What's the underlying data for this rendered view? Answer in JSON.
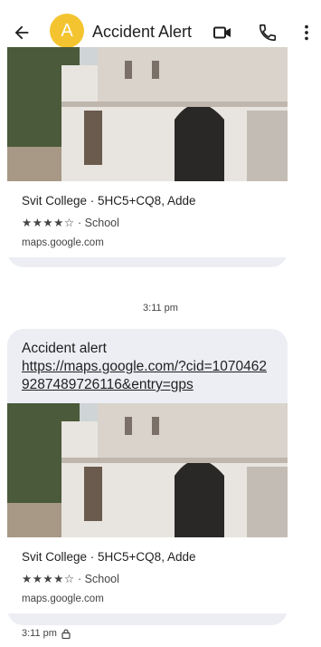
{
  "header": {
    "avatar_letter": "A",
    "title": "Accident Alert",
    "avatar_color": "#f4c430"
  },
  "messages": [
    {
      "preview": {
        "title": "Svit College · 5HC5+CQ8, Adde",
        "rating_stars": "★★★★☆",
        "category": "· School",
        "domain": "maps.google.com"
      }
    },
    {
      "text": "Accident alert",
      "link": "https://maps.google.com/?cid=10704629287489726116&entry=gps",
      "preview": {
        "title": "Svit College · 5HC5+CQ8, Adde",
        "rating_stars": "★★★★☆",
        "category": "· School",
        "domain": "maps.google.com"
      }
    }
  ],
  "timestamps": {
    "middle": "3:11 pm",
    "bottom": "3:11 pm"
  },
  "icons": [
    "back-arrow-icon",
    "video-call-icon",
    "phone-icon",
    "more-vert-icon",
    "lock-icon"
  ]
}
